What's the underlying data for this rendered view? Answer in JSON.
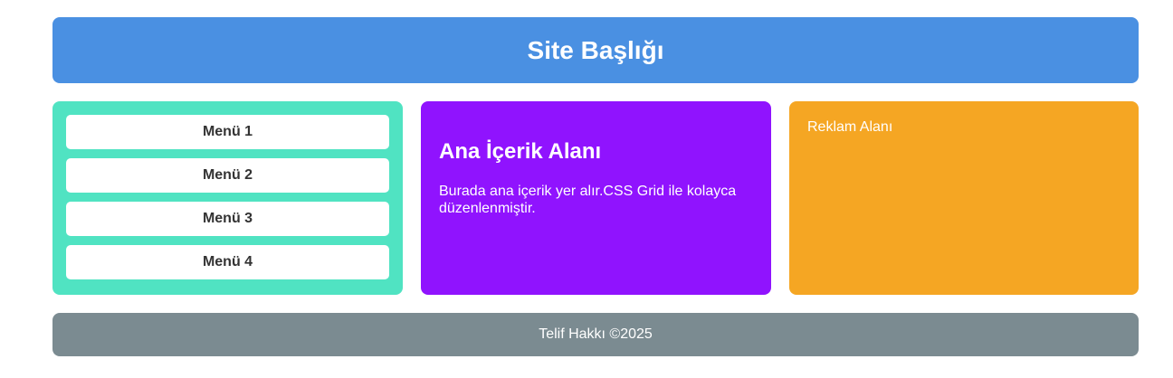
{
  "header": {
    "title": "Site Başlığı"
  },
  "sidebar": {
    "items": [
      {
        "label": "Menü 1"
      },
      {
        "label": "Menü 2"
      },
      {
        "label": "Menü 3"
      },
      {
        "label": "Menü 4"
      }
    ]
  },
  "main": {
    "title": "Ana İçerik Alanı",
    "body": "Burada ana içerik yer alır.CSS Grid ile kolayca düzenlenmiştir."
  },
  "ads": {
    "label": "Reklam Alanı"
  },
  "footer": {
    "text": "Telif Hakkı ©2025"
  },
  "colors": {
    "header": "#4a90e2",
    "sidebar": "#50e3c2",
    "main": "#9013fe",
    "ads": "#f5a623",
    "footer": "#7b8b91"
  }
}
